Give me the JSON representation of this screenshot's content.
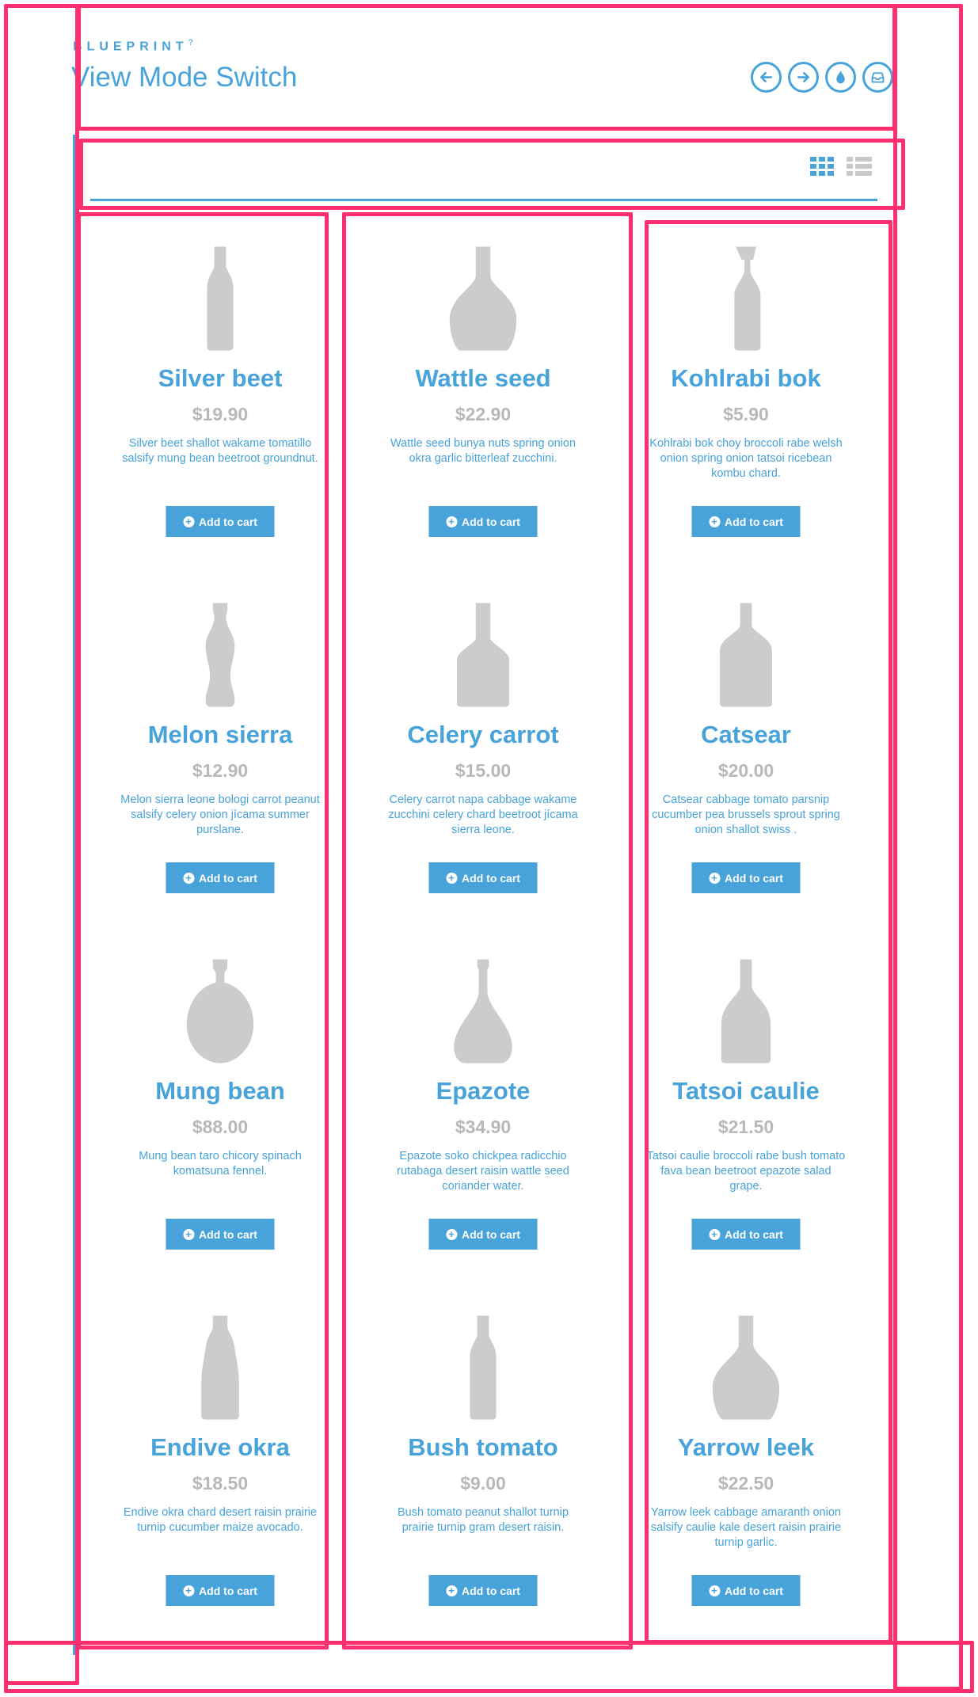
{
  "header": {
    "brand": "BLUEPRINT",
    "brand_mark": "?",
    "title": "View Mode Switch",
    "nav_icons": [
      "arrow-left-icon",
      "arrow-right-icon",
      "drop-icon",
      "inbox-icon"
    ]
  },
  "view_switch": {
    "active": "grid",
    "options": [
      "grid",
      "list"
    ]
  },
  "colors": {
    "accent": "#47a3da",
    "price": "#b8b8b8",
    "bottle": "#cccccc",
    "overlay": "#ff2e6e"
  },
  "add_label": "Add to cart",
  "products": [
    {
      "name": "Silver beet",
      "price": "$19.90",
      "desc": "Silver beet shallot wakame tomatillo salsify mung bean beetroot groundnut.",
      "bottle": "slim"
    },
    {
      "name": "Wattle seed",
      "price": "$22.90",
      "desc": "Wattle seed bunya nuts spring onion okra garlic bitterleaf zucchini.",
      "bottle": "flask"
    },
    {
      "name": "Kohlrabi bok",
      "price": "$5.90",
      "desc": "Kohlrabi bok choy broccoli rabe welsh onion spring onion tatsoi ricebean kombu chard.",
      "bottle": "swing"
    },
    {
      "name": "Melon sierra",
      "price": "$12.90",
      "desc": "Melon sierra leone bologi carrot peanut salsify celery onion jícama summer purslane.",
      "bottle": "cola"
    },
    {
      "name": "Celery carrot",
      "price": "$15.00",
      "desc": "Celery carrot napa cabbage wakame zucchini celery chard beetroot jícama sierra leone.",
      "bottle": "square"
    },
    {
      "name": "Catsear",
      "price": "$20.00",
      "desc": "Catsear cabbage tomato parsnip cucumber pea brussels sprout spring onion shallot swiss .",
      "bottle": "whisky"
    },
    {
      "name": "Mung bean",
      "price": "$88.00",
      "desc": "Mung bean taro chicory spinach komatsuna fennel.",
      "bottle": "round"
    },
    {
      "name": "Epazote",
      "price": "$34.90",
      "desc": "Epazote soko chickpea radicchio rutabaga desert raisin wattle seed coriander water.",
      "bottle": "drop"
    },
    {
      "name": "Tatsoi caulie",
      "price": "$21.50",
      "desc": "Tatsoi caulie broccoli rabe bush tomato fava bean beetroot epazote salad grape.",
      "bottle": "wine"
    },
    {
      "name": "Endive okra",
      "price": "$18.50",
      "desc": "Endive okra chard desert raisin prairie turnip cucumber maize avocado.",
      "bottle": "beer"
    },
    {
      "name": "Bush tomato",
      "price": "$9.00",
      "desc": "Bush tomato peanut shallot turnip prairie turnip gram desert raisin.",
      "bottle": "slim"
    },
    {
      "name": "Yarrow leek",
      "price": "$22.50",
      "desc": "Yarrow leek cabbage amaranth onion salsify caulie kale desert raisin prairie turnip garlic.",
      "bottle": "flask"
    }
  ]
}
